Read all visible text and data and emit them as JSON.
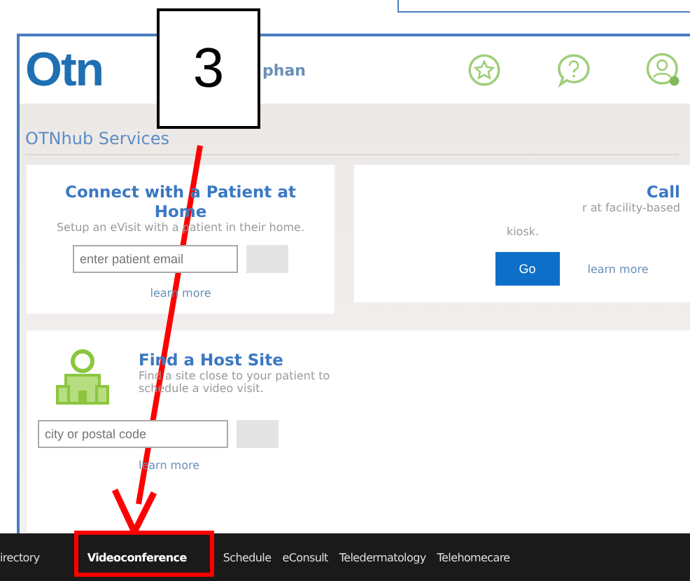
{
  "header": {
    "logo": "Otn",
    "user_name": "phan"
  },
  "section_title": "OTNhub Services",
  "cards": [
    {
      "kind": "form",
      "title": "Connect with a Patient at Home",
      "description": "Setup an eVisit with a patient in their home.",
      "placeholder": "enter patient email",
      "link": "learn more"
    },
    {
      "kind": "go",
      "title": "Call",
      "description": "r at facility-based",
      "description_2": "kiosk.",
      "button": "Go",
      "link": "learn more"
    },
    {
      "kind": "host",
      "title": "Find a Host Site",
      "description": "Find a site close to your patient to schedule a video visit.",
      "placeholder": "city or postal code",
      "link": "learn more"
    }
  ],
  "nav": [
    {
      "label": "irectory",
      "selected": false
    },
    {
      "label": "Videoconference",
      "selected": true
    },
    {
      "label": "Schedule",
      "selected": false
    },
    {
      "label": "eConsult",
      "selected": false
    },
    {
      "label": "Teledermatology",
      "selected": false
    },
    {
      "label": "Telehomecare",
      "selected": false
    }
  ],
  "annotation": {
    "label": "3"
  }
}
